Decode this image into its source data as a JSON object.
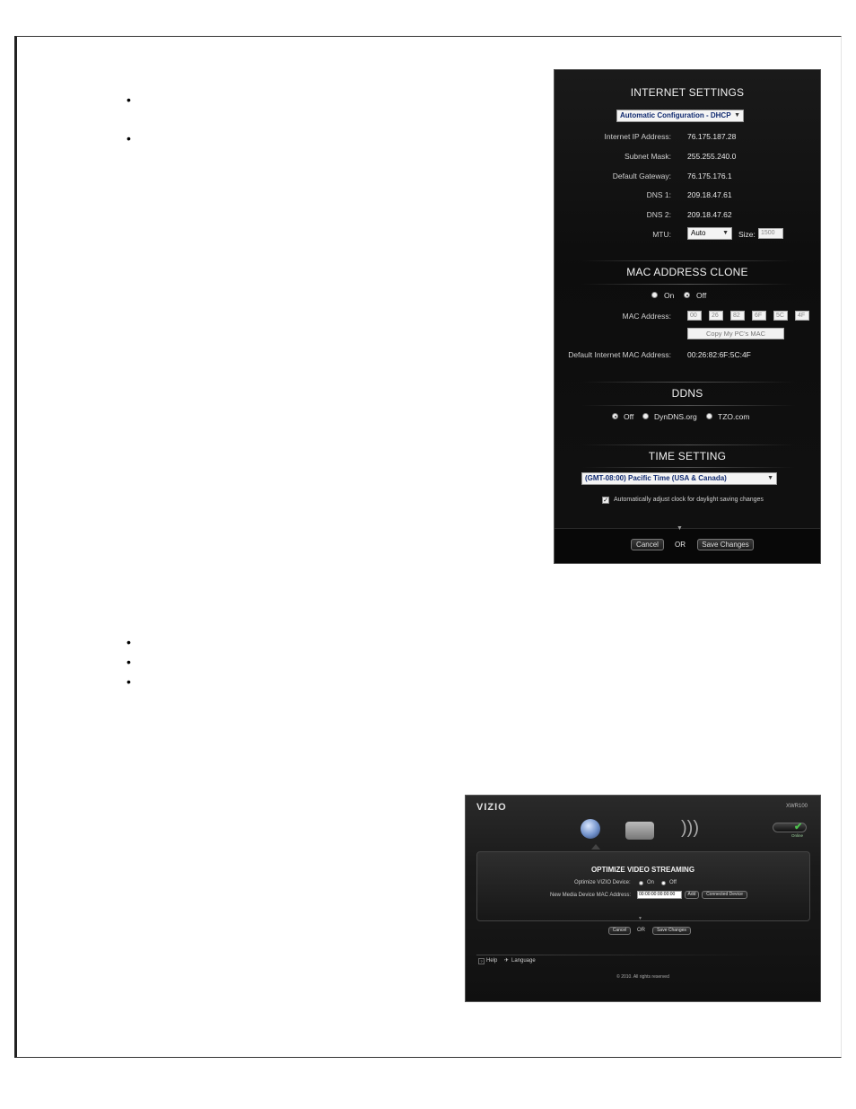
{
  "internet_settings": {
    "title": "INTERNET SETTINGS",
    "connection_type": "Automatic Configuration - DHCP",
    "rows": [
      {
        "label": "Internet IP Address:",
        "value": "76.175.187.28"
      },
      {
        "label": "Subnet Mask:",
        "value": "255.255.240.0"
      },
      {
        "label": "Default Gateway:",
        "value": "76.175.176.1"
      },
      {
        "label": "DNS 1:",
        "value": "209.18.47.61"
      },
      {
        "label": "DNS 2:",
        "value": "209.18.47.62"
      }
    ],
    "mtu_label": "MTU:",
    "mtu_value": "Auto",
    "size_label": "Size:",
    "size_value": "1500"
  },
  "mac_clone": {
    "title": "MAC ADDRESS CLONE",
    "on_label": "On",
    "off_label": "Off",
    "selected": "Off",
    "mac_label": "MAC Address:",
    "mac_octets": [
      "00",
      "26",
      "82",
      "6F",
      "5C",
      "4F"
    ],
    "copy_button": "Copy My PC's MAC",
    "default_mac_label": "Default Internet MAC Address:",
    "default_mac_value": "00:26:82:6F:5C:4F"
  },
  "ddns": {
    "title": "DDNS",
    "options": [
      "Off",
      "DynDNS.org",
      "TZO.com"
    ],
    "selected": "Off"
  },
  "time_setting": {
    "title": "TIME SETTING",
    "timezone": "(GMT-08:00) Pacific Time (USA & Canada)",
    "dst_label": "Automatically adjust clock for daylight saving changes",
    "dst_checked": true
  },
  "footer1": {
    "cancel": "Cancel",
    "or": "OR",
    "save": "Save Changes"
  },
  "video_streaming": {
    "logo": "VIZIO",
    "model": "XWR100",
    "status": "Online",
    "title": "OPTIMIZE VIDEO STREAMING",
    "optimize_label": "Optimize VIZIO Device:",
    "on_label": "On",
    "off_label": "Off",
    "mac_label": "New Media Device MAC Address:",
    "mac_value": "00:00:00:00:00:00",
    "add_button": "Add",
    "connected_button": "Connected Device",
    "cancel": "Cancel",
    "or": "OR",
    "save": "Save Changes",
    "help": "Help",
    "language": "Language",
    "copyright": "© 2010. All rights reserved"
  },
  "bullets": [
    "•",
    "•",
    "•",
    "•",
    "•"
  ]
}
